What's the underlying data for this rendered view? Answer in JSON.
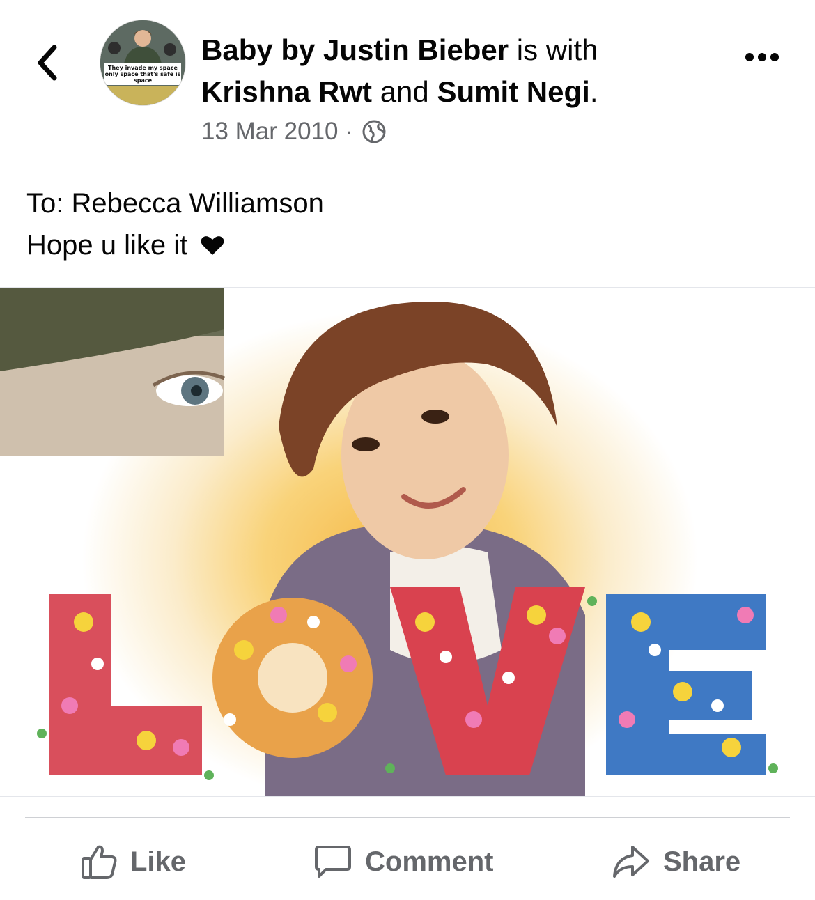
{
  "post": {
    "page_name": "Baby by Justin Bieber",
    "with_text": " is with",
    "tagged_1": "Krishna Rwt",
    "and_text": " and ",
    "tagged_2": "Sumit Negi",
    "period": ".",
    "date": "13 Mar 2010",
    "separator": "·",
    "audience_icon": "globe-icon",
    "avatar_caption": "They invade my space only space that's safe is space",
    "body_line_1": "To: Rebecca Williamson",
    "body_line_2": "Hope u like it",
    "body_emoji": "heart-icon",
    "photo_text": "LOVE"
  },
  "actions": {
    "like_label": "Like",
    "comment_label": "Comment",
    "share_label": "Share"
  },
  "icons": {
    "back": "chevron-left-icon",
    "more": "more-options-icon"
  },
  "colors": {
    "text_primary": "#050505",
    "text_secondary": "#65676b",
    "divider": "#ced0d4"
  }
}
